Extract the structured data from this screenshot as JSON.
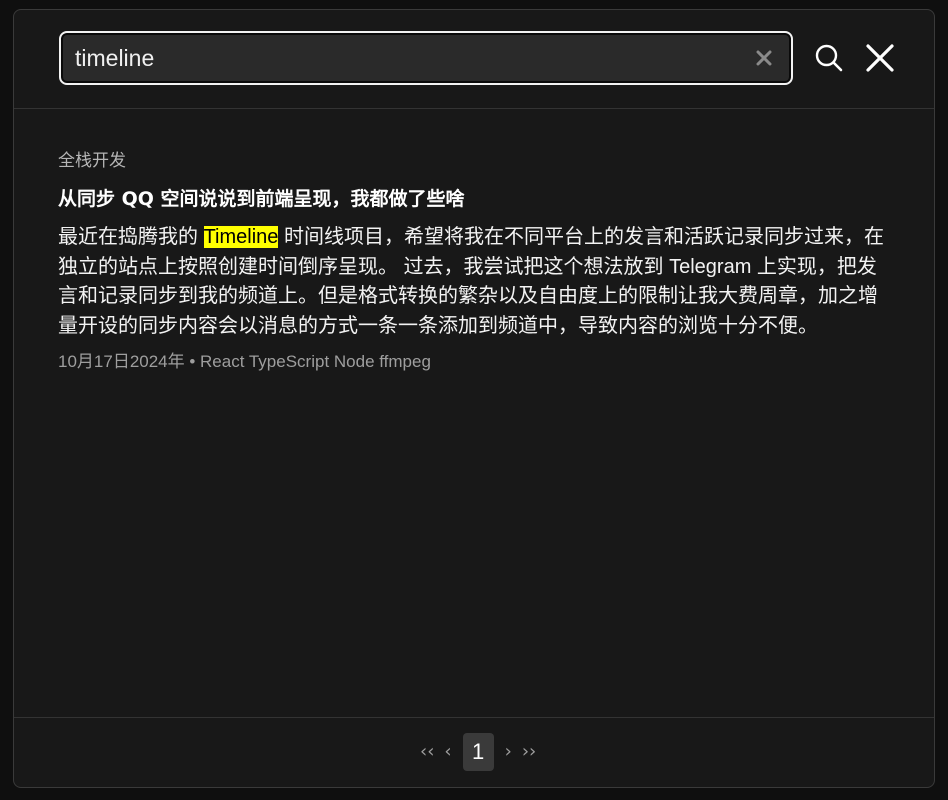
{
  "search": {
    "value": "timeline",
    "placeholder": ""
  },
  "results": [
    {
      "category": "全栈开发",
      "title": "从同步 QQ 空间说说到前端呈现，我都做了些啥",
      "excerpt_before": "最近在捣腾我的 ",
      "excerpt_highlight": "Timeline",
      "excerpt_after": " 时间线项目，希望将我在不同平台上的发言和活跃记录同步过来，在独立的站点上按照创建时间倒序呈现。 过去，我尝试把这个想法放到 Telegram 上实现，把发言和记录同步到我的频道上。但是格式转换的繁杂以及自由度上的限制让我大费周章，加之增量开设的同步内容会以消息的方式一条一条添加到频道中，导致内容的浏览十分不便。",
      "meta": "10月17日2024年 • React TypeScript Node ffmpeg"
    }
  ],
  "pagination": {
    "first": "‹‹",
    "prev": "‹",
    "current": "1",
    "next": "›",
    "last": "››"
  },
  "icons": {
    "clear": "clear-icon",
    "search": "search-icon",
    "close": "close-icon"
  },
  "colors": {
    "highlight": "#ffff00",
    "modal_bg": "#181818",
    "input_border": "#f2f2f2"
  }
}
